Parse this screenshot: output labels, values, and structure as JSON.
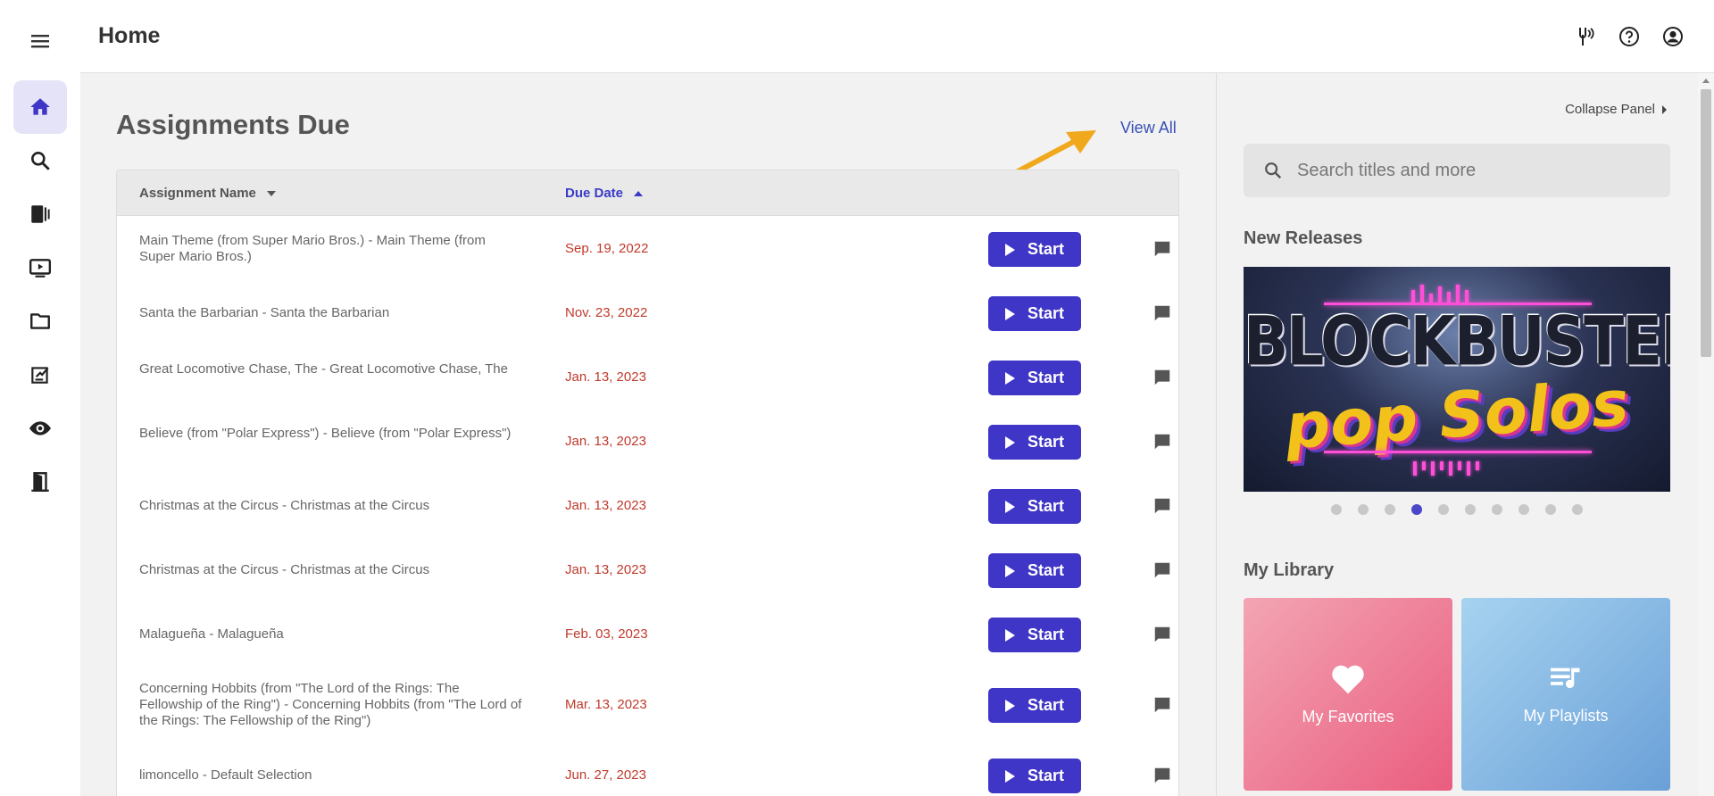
{
  "header": {
    "title": "Home"
  },
  "sidebar": {
    "items": [
      {
        "name": "home",
        "icon": "home-icon",
        "active": true
      },
      {
        "name": "search",
        "icon": "search-icon"
      },
      {
        "name": "library",
        "icon": "book-icon"
      },
      {
        "name": "video",
        "icon": "monitor-play-icon"
      },
      {
        "name": "folder",
        "icon": "folder-icon"
      },
      {
        "name": "assignments",
        "icon": "assignment-icon"
      },
      {
        "name": "watch",
        "icon": "eye-icon"
      },
      {
        "name": "exit",
        "icon": "exit-door-icon"
      }
    ]
  },
  "assignments": {
    "title": "Assignments Due",
    "view_all": "View All",
    "columns": {
      "name": "Assignment Name",
      "due": "Due Date"
    },
    "start_label": "Start",
    "rows": [
      {
        "name": "Main Theme (from Super Mario Bros.) - Main Theme (from Super Mario Bros.)",
        "due": "Sep. 19, 2022"
      },
      {
        "name": "Santa the Barbarian - Santa the Barbarian",
        "due": "Nov. 23, 2022"
      },
      {
        "name": "Great Locomotive Chase, The - Great Locomotive Chase, The",
        "due": "Jan. 13, 2023"
      },
      {
        "name": "Believe (from \"Polar Express\") - Believe (from \"Polar Express\")",
        "due": "Jan. 13, 2023"
      },
      {
        "name": "Christmas at the Circus - Christmas at the Circus",
        "due": "Jan. 13, 2023"
      },
      {
        "name": "Christmas at the Circus - Christmas at the Circus",
        "due": "Jan. 13, 2023"
      },
      {
        "name": "Malagueña - Malagueña",
        "due": "Feb. 03, 2023"
      },
      {
        "name": "Concerning Hobbits (from \"The Lord of the Rings: The Fellowship of the Ring\") - Concerning Hobbits (from \"The Lord of the Rings: The Fellowship of the Ring\")",
        "due": "Mar. 13, 2023"
      },
      {
        "name": "limoncello - Default Selection",
        "due": "Jun. 27, 2023"
      }
    ]
  },
  "panel": {
    "collapse_label": "Collapse Panel",
    "search_placeholder": "Search titles and more",
    "new_releases_title": "New Releases",
    "banner": {
      "title": "BLOCKBUSTER",
      "subtitle": "pop Solos"
    },
    "carousel": {
      "count": 10,
      "active_index": 3
    },
    "my_library_title": "My Library",
    "tiles": {
      "favorites": "My Favorites",
      "playlists": "My Playlists"
    }
  },
  "colors": {
    "accent": "#3f35c6",
    "due_date": "#c0392b",
    "link": "#3a4fb5",
    "annotation_arrow": "#f0a81c"
  }
}
